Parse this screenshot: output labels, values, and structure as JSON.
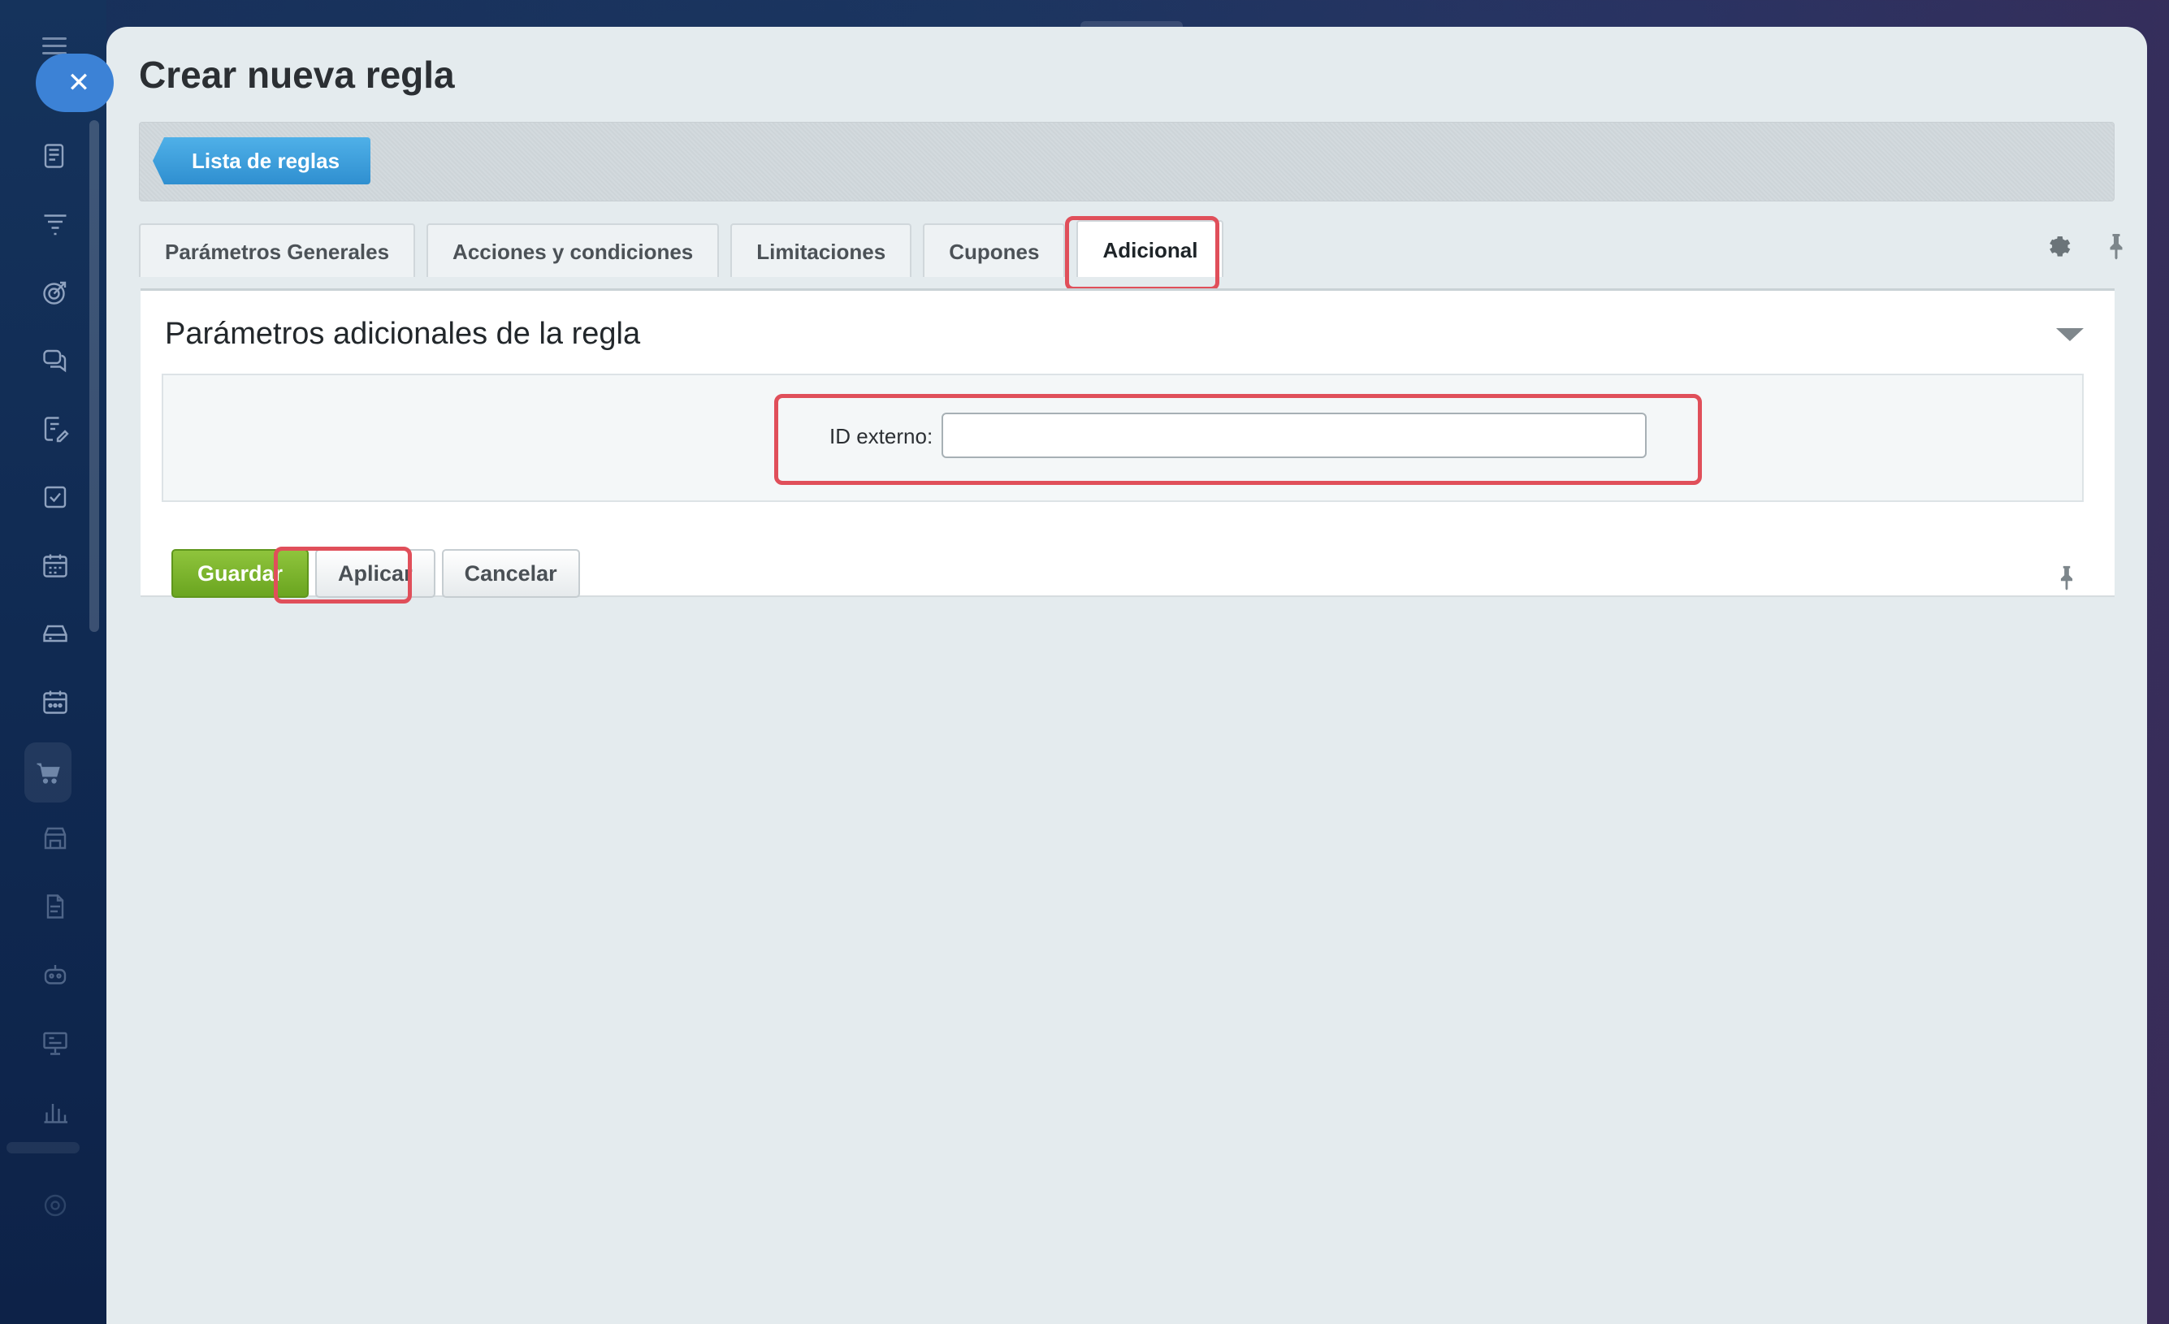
{
  "page": {
    "title": "Crear nueva regla"
  },
  "toolbar": {
    "back_label": "Lista de reglas"
  },
  "tabs": [
    {
      "label": "Parámetros Generales",
      "active": false
    },
    {
      "label": "Acciones y condiciones",
      "active": false
    },
    {
      "label": "Limitaciones",
      "active": false
    },
    {
      "label": "Cupones",
      "active": false
    },
    {
      "label": "Adicional",
      "active": true
    }
  ],
  "section": {
    "title": "Parámetros adicionales de la regla"
  },
  "form": {
    "external_id_label": "ID externo:",
    "external_id_value": ""
  },
  "actions": {
    "save_label": "Guardar",
    "apply_label": "Aplicar",
    "cancel_label": "Cancelar"
  },
  "colors": {
    "highlight": "#e04f5a",
    "primary_button": "#7ab62e",
    "back_button": "#3a9bdc",
    "close_button": "#3c82d6"
  },
  "icons": {
    "sidebar": [
      "news-icon",
      "filter-icon",
      "target-icon",
      "chat-icon",
      "edit-doc-icon",
      "checkbox-icon",
      "calendar-grid-icon",
      "drive-icon",
      "calendar-icon",
      "cart-icon",
      "store-icon",
      "document-icon",
      "robot-icon",
      "presentation-icon",
      "bar-chart-icon",
      "settings-icon"
    ]
  }
}
